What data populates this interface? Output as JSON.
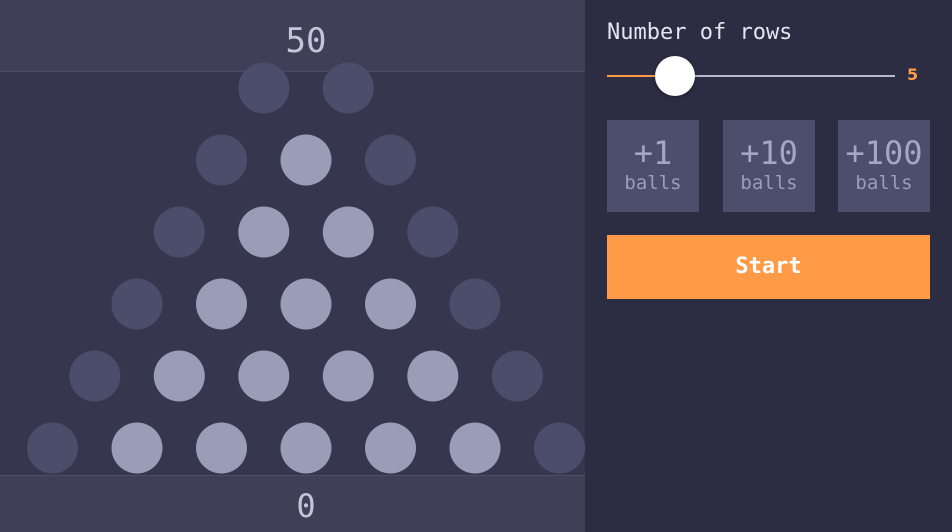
{
  "board": {
    "top_count": "50",
    "bottom_count": "0",
    "peg_rows": 6,
    "colors": {
      "peg_light": "#9a9db8",
      "peg_dark": "#4b4d6b"
    }
  },
  "controls": {
    "rows_label": "Number of rows",
    "rows_value": "5",
    "rows_value_number": 5,
    "rows_min": 1,
    "rows_max": 50,
    "add_buttons": [
      {
        "amount": "+1",
        "unit": "balls"
      },
      {
        "amount": "+10",
        "unit": "balls"
      },
      {
        "amount": "+100",
        "unit": "balls"
      }
    ],
    "start_label": "Start"
  },
  "colors": {
    "accent": "#ff9a47",
    "panel_bg": "#2c2d42",
    "board_bg": "#36374f",
    "button_bg": "#4c4e6b"
  }
}
